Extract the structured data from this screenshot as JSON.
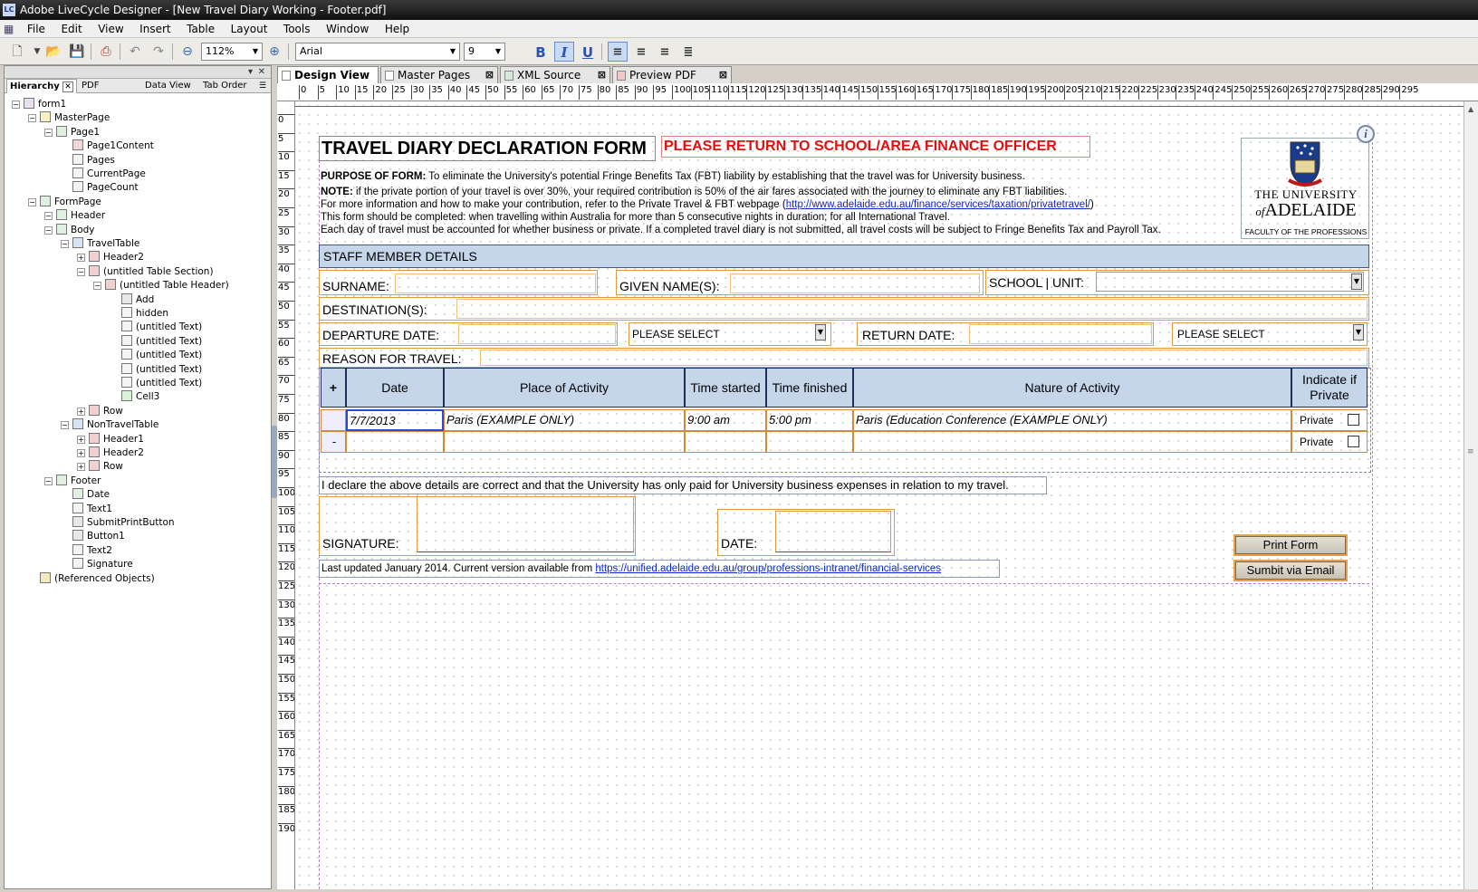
{
  "window": {
    "title": "Adobe LiveCycle Designer - [New Travel Diary Working - Footer.pdf]",
    "app_icon": "LC"
  },
  "menu": [
    "File",
    "Edit",
    "View",
    "Insert",
    "Table",
    "Layout",
    "Tools",
    "Window",
    "Help"
  ],
  "toolbar": {
    "zoom": "112%",
    "font": "Arial",
    "size": "9",
    "bold": "B",
    "italic": "I",
    "underline": "U"
  },
  "left_panel": {
    "tabs": [
      "Hierarchy",
      "PDF Structure",
      "Data View",
      "Tab Order"
    ],
    "tree": [
      {
        "label": "form1",
        "depth": 0,
        "icon": "form-icon"
      },
      {
        "label": "MasterPage",
        "depth": 1,
        "icon": "masterpage-icon"
      },
      {
        "label": "Page1",
        "depth": 2,
        "icon": "page-icon"
      },
      {
        "label": "Page1Content",
        "depth": 3,
        "icon": "content-area-icon"
      },
      {
        "label": "Pages",
        "depth": 3,
        "icon": "text-field-icon"
      },
      {
        "label": "CurrentPage",
        "depth": 3,
        "icon": "text-field-icon"
      },
      {
        "label": "PageCount",
        "depth": 3,
        "icon": "text-field-icon"
      },
      {
        "label": "FormPage",
        "depth": 1,
        "icon": "page-icon"
      },
      {
        "label": "Header",
        "depth": 2,
        "icon": "subform-icon"
      },
      {
        "label": "Body",
        "depth": 2,
        "icon": "subform-icon"
      },
      {
        "label": "TravelTable",
        "depth": 3,
        "icon": "table-icon"
      },
      {
        "label": "Header2",
        "depth": 4,
        "icon": "table-row-icon"
      },
      {
        "label": "(untitled Table Section)",
        "depth": 4,
        "icon": "table-section-icon"
      },
      {
        "label": "(untitled Table Header)",
        "depth": 5,
        "icon": "table-row-icon"
      },
      {
        "label": "Add",
        "depth": 6,
        "icon": "button-icon"
      },
      {
        "label": "hidden",
        "depth": 6,
        "icon": "text-field-icon"
      },
      {
        "label": "(untitled Text)",
        "depth": 6,
        "icon": "text-field-icon"
      },
      {
        "label": "(untitled Text)",
        "depth": 6,
        "icon": "text-field-icon"
      },
      {
        "label": "(untitled Text)",
        "depth": 6,
        "icon": "text-field-icon"
      },
      {
        "label": "(untitled Text)",
        "depth": 6,
        "icon": "text-field-icon"
      },
      {
        "label": "(untitled Text)",
        "depth": 6,
        "icon": "text-field-icon"
      },
      {
        "label": "Cell3",
        "depth": 6,
        "icon": "checkbox-icon"
      },
      {
        "label": "Row",
        "depth": 4,
        "icon": "table-row-icon"
      },
      {
        "label": "NonTravelTable",
        "depth": 3,
        "icon": "table-icon"
      },
      {
        "label": "Header1",
        "depth": 4,
        "icon": "table-row-icon"
      },
      {
        "label": "Header2",
        "depth": 4,
        "icon": "table-row-icon"
      },
      {
        "label": "Row",
        "depth": 4,
        "icon": "table-row-icon"
      },
      {
        "label": "Footer",
        "depth": 2,
        "icon": "subform-icon"
      },
      {
        "label": "Date",
        "depth": 3,
        "icon": "date-field-icon"
      },
      {
        "label": "Text1",
        "depth": 3,
        "icon": "text-field-icon"
      },
      {
        "label": "SubmitPrintButton",
        "depth": 3,
        "icon": "button-icon"
      },
      {
        "label": "Button1",
        "depth": 3,
        "icon": "button-icon"
      },
      {
        "label": "Text2",
        "depth": 3,
        "icon": "text-field-icon"
      },
      {
        "label": "Signature",
        "depth": 3,
        "icon": "signature-icon"
      },
      {
        "label": "(Referenced Objects)",
        "depth": 1,
        "icon": "referenced-objects-icon"
      }
    ]
  },
  "doc_tabs": [
    {
      "label": "Design View",
      "active": true
    },
    {
      "label": "Master Pages",
      "active": false
    },
    {
      "label": "XML Source",
      "active": false
    },
    {
      "label": "Preview PDF",
      "active": false
    }
  ],
  "ruler_h": [
    "0",
    "5",
    "10",
    "15",
    "20",
    "25",
    "30",
    "35",
    "40",
    "45",
    "50",
    "55",
    "60",
    "65",
    "70",
    "75",
    "80",
    "85",
    "90",
    "95",
    "100",
    "105",
    "110",
    "115",
    "120",
    "125",
    "130",
    "135",
    "140",
    "145",
    "150",
    "155",
    "160",
    "165",
    "170",
    "175",
    "180",
    "185",
    "190",
    "195",
    "200",
    "205",
    "210",
    "215",
    "220",
    "225",
    "230",
    "235",
    "240",
    "245",
    "250",
    "255",
    "260",
    "265",
    "270",
    "275",
    "280",
    "285",
    "290",
    "295"
  ],
  "ruler_v": [
    "0",
    "5",
    "10",
    "15",
    "20",
    "25",
    "30",
    "35",
    "40",
    "45",
    "50",
    "55",
    "60",
    "65",
    "70",
    "75",
    "80",
    "85",
    "90",
    "95",
    "100",
    "105",
    "110",
    "115",
    "120",
    "125",
    "130",
    "135",
    "140",
    "145",
    "150",
    "155",
    "160",
    "165",
    "170",
    "175",
    "180",
    "185",
    "190"
  ],
  "form": {
    "title": "TRAVEL DIARY DECLARATION FORM",
    "return_notice": "PLEASE RETURN TO SCHOOL/AREA FINANCE OFFICER",
    "purpose_label": "PURPOSE OF FORM:",
    "purpose_text": " To eliminate the University's potential Fringe Benefits Tax (FBT) liability by establishing that the travel was for University business.",
    "note_label": "NOTE:",
    "note_text": " if the private portion of your travel is over 30%, your required contribution is 50% of the air fares associated with the journey to eliminate any FBT liabilities.",
    "more_info_text": "For more information and how to make your contribution, refer to the Private Travel & FBT webpage (",
    "more_info_link": "http://www.adelaide.edu.au/finance/services/taxation/privatetravel/",
    "more_info_close": ")",
    "completed_text": "This form should be completed: when travelling within Australia for more than 5 consecutive nights in duration; for all International Travel.",
    "each_day_text": "Each day of travel must be accounted for whether business or private. If a completed travel diary is not submitted, all travel costs will be subject to Fringe Benefits Tax and Payroll Tax.",
    "logo_line1": "THE UNIVERSITY",
    "logo_line2_of": "of",
    "logo_line2": "ADELAIDE",
    "logo_faculty": "FACULTY OF THE PROFESSIONS",
    "staff_header": "STAFF MEMBER DETAILS",
    "surname_label": "SURNAME:",
    "given_label": "GIVEN NAME(S):",
    "school_label": "SCHOOL | UNIT:",
    "destination_label": "DESTINATION(S):",
    "departure_label": "DEPARTURE DATE:",
    "please_select_1": "PLEASE SELECT",
    "return_label": "RETURN DATE:",
    "please_select_2": "PLEASE SELECT",
    "reason_label": "REASON FOR TRAVEL:",
    "table": {
      "add_label": "+",
      "headers": [
        "Date",
        "Place of Activity",
        "Time started",
        "Time finished",
        "Nature of Activity",
        "Indicate if Private"
      ],
      "rows": [
        {
          "cells": [
            "7/7/2013",
            "Paris (EXAMPLE ONLY)",
            "9:00 am",
            "5:00 pm",
            "Paris (Education Conference (EXAMPLE ONLY)"
          ],
          "private": "Private",
          "remove": ""
        },
        {
          "cells": [
            "",
            "",
            "",
            "",
            ""
          ],
          "private": "Private",
          "remove": "-"
        }
      ]
    },
    "declaration": "I declare the above details are correct and that the University has only paid for University business expenses in relation to my travel.",
    "signature_label": "SIGNATURE:",
    "date_label": "DATE:",
    "print_button": "Print Form",
    "submit_button": "Sumbit via Email",
    "updated_text": "Last updated January 2014. Current version available from ",
    "updated_link": "https://unified.adelaide.edu.au/group/professions-intranet/financial-services"
  },
  "colors": {
    "accent_blue": "#c6d6ea",
    "border_orange": "#e09a40",
    "notice_red": "#e01010",
    "link_blue": "#0a2ad0"
  }
}
